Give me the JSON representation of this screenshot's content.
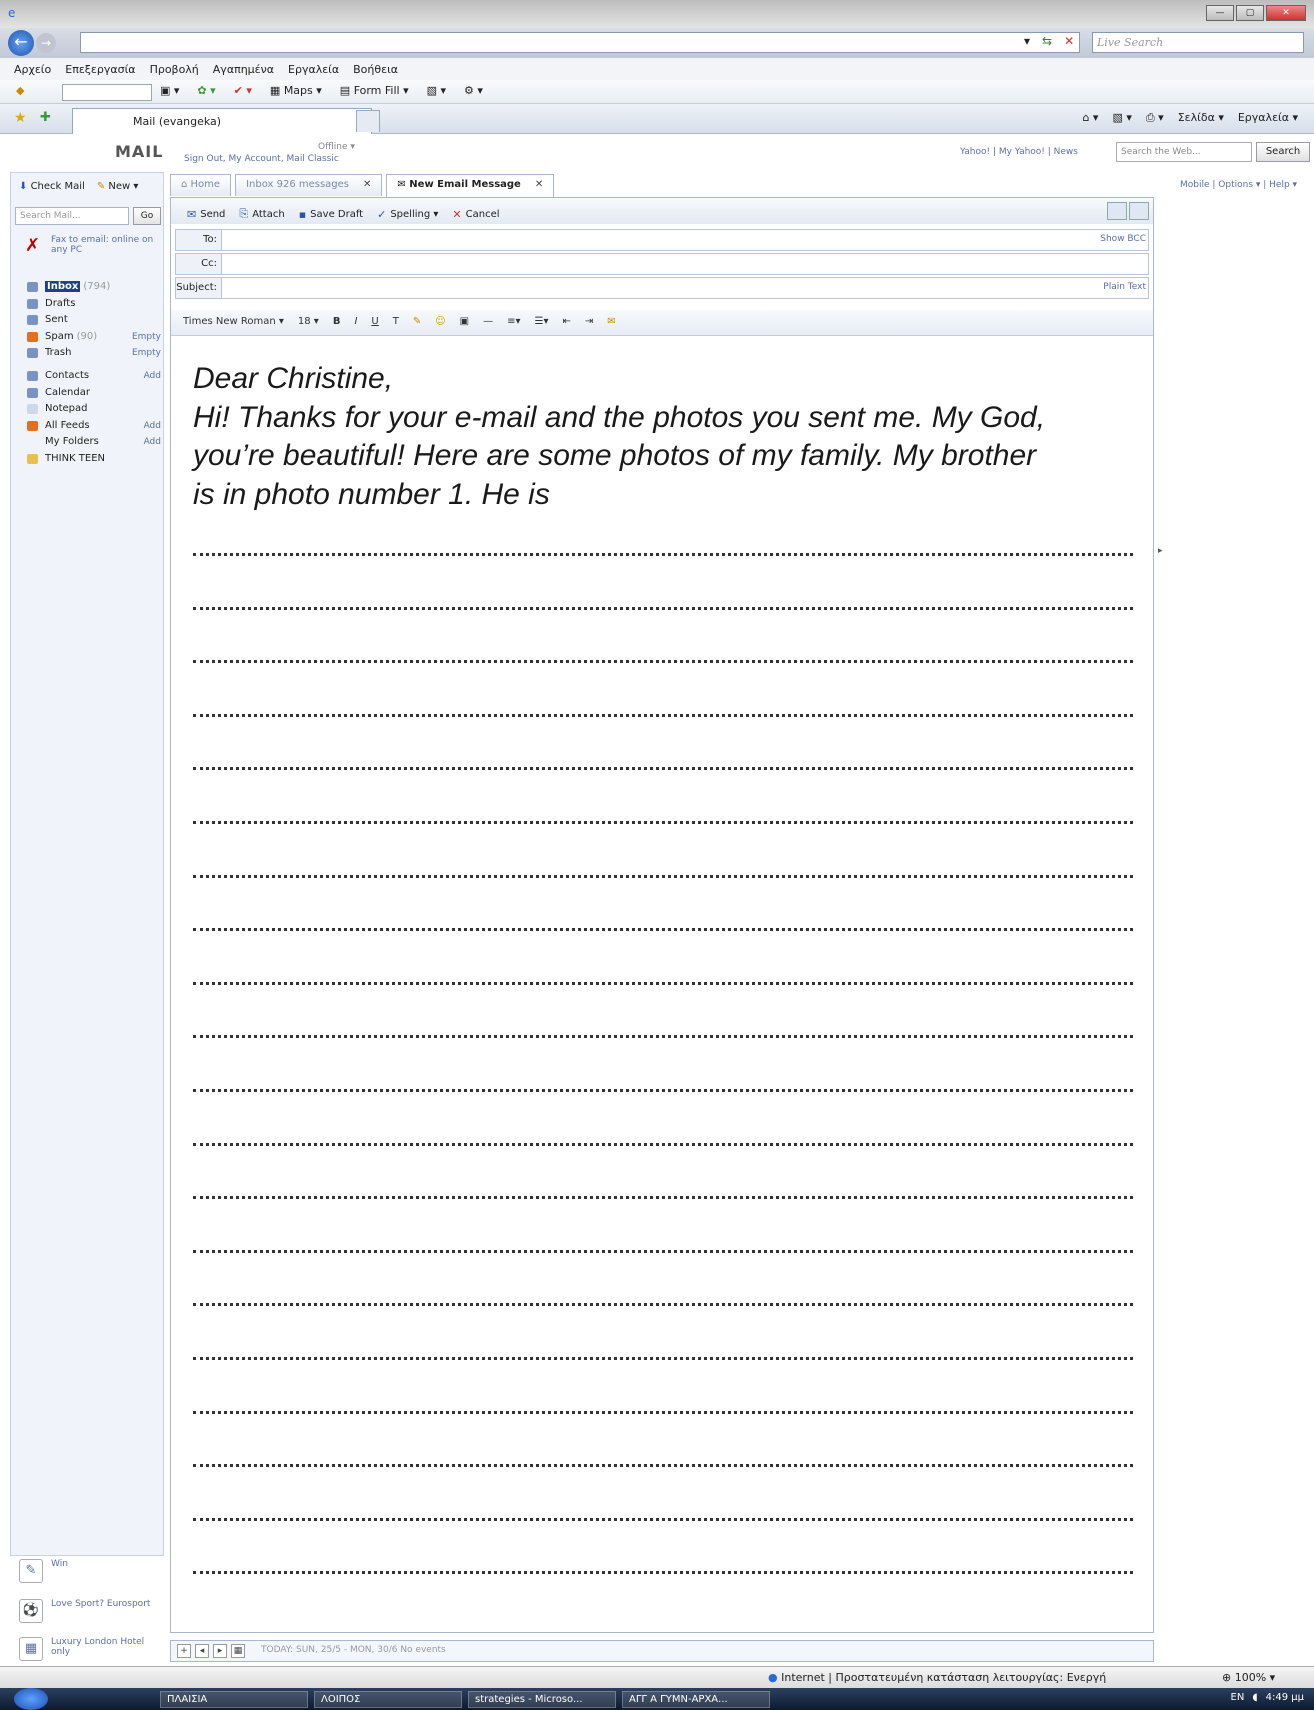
{
  "ie": {
    "live_search_placeholder": "Live Search",
    "menu": [
      "Αρχείο",
      "Επεξεργασία",
      "Προβολή",
      "Αγαπημένα",
      "Εργαλεία",
      "Βοήθεια"
    ],
    "toolbar": [
      "Maps",
      "Form Fill"
    ],
    "tab_title": "Mail (evangeka)",
    "right_tools": [
      "Σελίδα ▾",
      "Εργαλεία ▾"
    ]
  },
  "yahoo": {
    "logo": "MAIL",
    "offline": "Offline ▾",
    "account_links": "Sign Out, My Account, Mail Classic",
    "right_links": "Yahoo!  |  My Yahoo!  |  News",
    "search_web_placeholder": "Search the Web...",
    "search_button": "Search",
    "top_right_links": "Mobile  |  Options ▾  |  Help ▾"
  },
  "sidebar": {
    "check_mail": "Check Mail",
    "new": "New ▾",
    "search_placeholder": "Search Mail...",
    "go": "Go",
    "fax_promo": "Fax to email: online on any PC",
    "folders": [
      {
        "label": "Inbox",
        "count": "(794)",
        "action": "",
        "selected": true
      },
      {
        "label": "Drafts",
        "count": "",
        "action": ""
      },
      {
        "label": "Sent",
        "count": "",
        "action": ""
      },
      {
        "label": "Spam",
        "count": "(90)",
        "action": "Empty"
      },
      {
        "label": "Trash",
        "count": "",
        "action": "Empty"
      }
    ],
    "apps": [
      {
        "label": "Contacts",
        "action": "Add"
      },
      {
        "label": "Calendar",
        "action": ""
      },
      {
        "label": "Notepad",
        "action": ""
      },
      {
        "label": "All Feeds",
        "action": "Add"
      },
      {
        "label": "My Folders",
        "action": "Add"
      },
      {
        "label": "THINK TEEN",
        "action": ""
      }
    ],
    "ads": [
      {
        "label": "Win"
      },
      {
        "label": "Love Sport? Eurosport"
      },
      {
        "label": "Luxury London Hotel only"
      }
    ]
  },
  "tabs": [
    {
      "label": "Home"
    },
    {
      "label": "Inbox 926 messages"
    },
    {
      "label": "New Email Message"
    }
  ],
  "compose": {
    "toolbar": [
      "Send",
      "Attach",
      "Save Draft",
      "Spelling ▾",
      "Cancel"
    ],
    "to_label": "To:",
    "cc_label": "Cc:",
    "subject_label": "Subject:",
    "show_bcc": "Show BCC",
    "plain_text": "Plain Text",
    "font_name": "Times New Roman ▾",
    "font_size": "18 ▾",
    "letter_lines": [
      "Dear Christine,",
      "Hi! Thanks for your e-mail and the photos you sent me. My God,",
      "you’re beautiful! Here are some photos of my family. My brother",
      "is in photo number 1. He is"
    ],
    "blank_line_count": 20,
    "footer": "TODAY: SUN, 25/5 - MON, 30/6  No events"
  },
  "status": {
    "zone": "Internet | Προστατευμένη κατάσταση λειτουργίας: Ενεργή",
    "zoom": "100%"
  },
  "taskbar": {
    "items": [
      "ΠΛΑΙΣΙΑ",
      "ΛΟΙΠΟΣ",
      "strategies - Microso...",
      "ΑΓΓ Α ΓΥΜΝ-ΑΡΧΑ..."
    ],
    "lang": "EN",
    "time": "4:49 μμ"
  }
}
